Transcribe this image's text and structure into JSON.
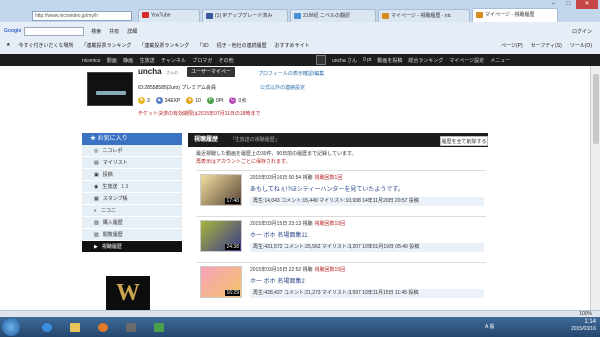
{
  "browser": {
    "address": "http://www.nicovideo.jp/my/h",
    "tabs": [
      {
        "label": "YouTube",
        "color": "#d92b2b"
      },
      {
        "label": "(1) IPアップグレード済み",
        "color": "#3b5998"
      },
      {
        "label": "21世紀 ニベルの翻訳",
        "color": "#4a90d9"
      },
      {
        "label": "マイページ - 視聴履歴 - nic",
        "color": "#d68a1c"
      },
      {
        "label": "マイページ - 視聴履歴",
        "color": "#d68a1c"
      }
    ],
    "google_label": "Google",
    "toolbar_items": [
      "検索",
      "共有",
      "詳細",
      "ログイン"
    ],
    "favorites": [
      "今すぐ付きいだくな場所",
      "「連載投票ランキング",
      "「連載投票ランキング",
      "「3D",
      "招き・他社の連続履歴",
      "おすすめサイト"
    ],
    "menu_items": [
      "ページ(P)",
      "セーフティ(S)",
      "ツール(O)"
    ]
  },
  "niconico": {
    "nav": [
      "niconico",
      "動画",
      "静画",
      "生放送",
      "チャンネル",
      "ブロマガ",
      "その他"
    ],
    "user": "uncha さん",
    "points": "0 pt",
    "right_nav": [
      "動画を投稿",
      "総合ランキング",
      "マイページ設定",
      "メニュー"
    ]
  },
  "profile": {
    "username": "uncha",
    "suffix": "さんの",
    "mylist_button": "ユーザーマイページ",
    "profile_link": "プロフィールの表示確認/編集",
    "id_line": "ID:28558585(2uro) プレミアム会員",
    "mail_note": "公式以外の連絡設定",
    "stats": [
      {
        "value": "3",
        "icon": "star-icon",
        "color": "#e7b521"
      },
      {
        "value": "34EXP",
        "icon": "exp-icon",
        "color": "#5a7ec4"
      },
      {
        "value": "10",
        "icon": "coin-icon",
        "color": "#e7a621"
      },
      {
        "value": "0Pt",
        "icon": "point-icon",
        "color": "#4aa04a"
      },
      {
        "value": "0点",
        "icon": "score-icon",
        "color": "#b44ab4"
      }
    ],
    "warning": "チケット決済の有効期限は2015年07月11日の18時まで"
  },
  "sidebar": {
    "header": "お気に入り",
    "items": [
      {
        "label": "ニコレポ",
        "count": ""
      },
      {
        "label": "マイリスト",
        "count": ""
      },
      {
        "label": "投稿",
        "count": ""
      },
      {
        "label": "生放送",
        "count": "1  3"
      },
      {
        "label": "スタンプ帳",
        "count": ""
      },
      {
        "label": "ニコニ",
        "count": ""
      },
      {
        "label": "購入履歴",
        "count": ""
      },
      {
        "label": "閲覧履歴",
        "count": ""
      },
      {
        "label": "視聴履歴",
        "count": ""
      }
    ],
    "logo_text": "W"
  },
  "main": {
    "title": "視聴履歴",
    "subtitle": "「生放送の視聴履歴」",
    "delete_all": "履歴を全て削除する",
    "note": "最近視聴した動画を履歴上の30件、90日前の履歴まで記録しています。",
    "note2": "再表示はアカウントごとに保存されます。",
    "entries": [
      {
        "date": "2015年03月16日 00:54 視聴",
        "tag": "視聴回数1回",
        "title": "あもしてねぇ!?ほシティーハンターを見ていたようです。",
        "meta": "再生:14,043  コメント:15,449  マイリスト:10,938  14年11月20日 20:57 投稿",
        "length": "17:48"
      },
      {
        "date": "2015年03月15日 23:13 視聴",
        "tag": "視聴回数10回",
        "title": "ホー ボホ  名場面集11",
        "meta": "再生:431,572  コメント:25,562  マイリスト:3,207  10年01月19日 05:40 投稿",
        "length": "24:38"
      },
      {
        "date": "2015年03月15日 22:52 視聴",
        "tag": "視聴回数15回",
        "title": "ホー ボホ  名場面集2",
        "meta": "再生:428,437  コメント:21,273  マイリスト:3,597  10年11月15日 11:45 投稿",
        "length": "16:29"
      }
    ]
  },
  "statusbar": {
    "zoom": "100%"
  },
  "taskbar": {
    "time": "1:14",
    "date": "2015/03/16",
    "lang": "A 般"
  }
}
